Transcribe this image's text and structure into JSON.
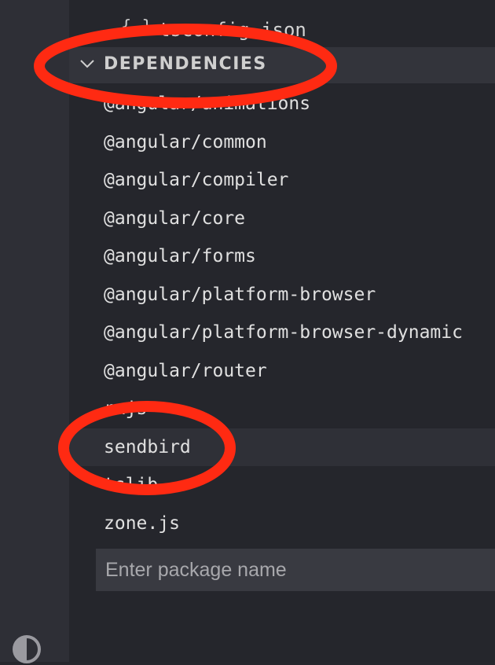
{
  "file_row": {
    "icon": "braces-icon",
    "brace_glyph": "{ }",
    "name": "tsconfig.json"
  },
  "dependencies": {
    "title": "DEPENDENCIES",
    "expanded": true,
    "items": [
      {
        "label": "@angular/animations"
      },
      {
        "label": "@angular/common"
      },
      {
        "label": "@angular/compiler"
      },
      {
        "label": "@angular/core"
      },
      {
        "label": "@angular/forms"
      },
      {
        "label": "@angular/platform-browser"
      },
      {
        "label": "@angular/platform-browser-dynamic"
      },
      {
        "label": "@angular/router"
      },
      {
        "label": "rxjs"
      },
      {
        "label": "sendbird"
      },
      {
        "label": "tslib"
      },
      {
        "label": "zone.js"
      }
    ],
    "selected_item": "sendbird"
  },
  "package_input": {
    "placeholder": "Enter package name",
    "value": ""
  },
  "colors": {
    "annotation": "#ff2a12",
    "background": "#25262c",
    "activity_bar": "#2e2f36",
    "header_background": "#33343b",
    "text": "#e0e0e0"
  }
}
